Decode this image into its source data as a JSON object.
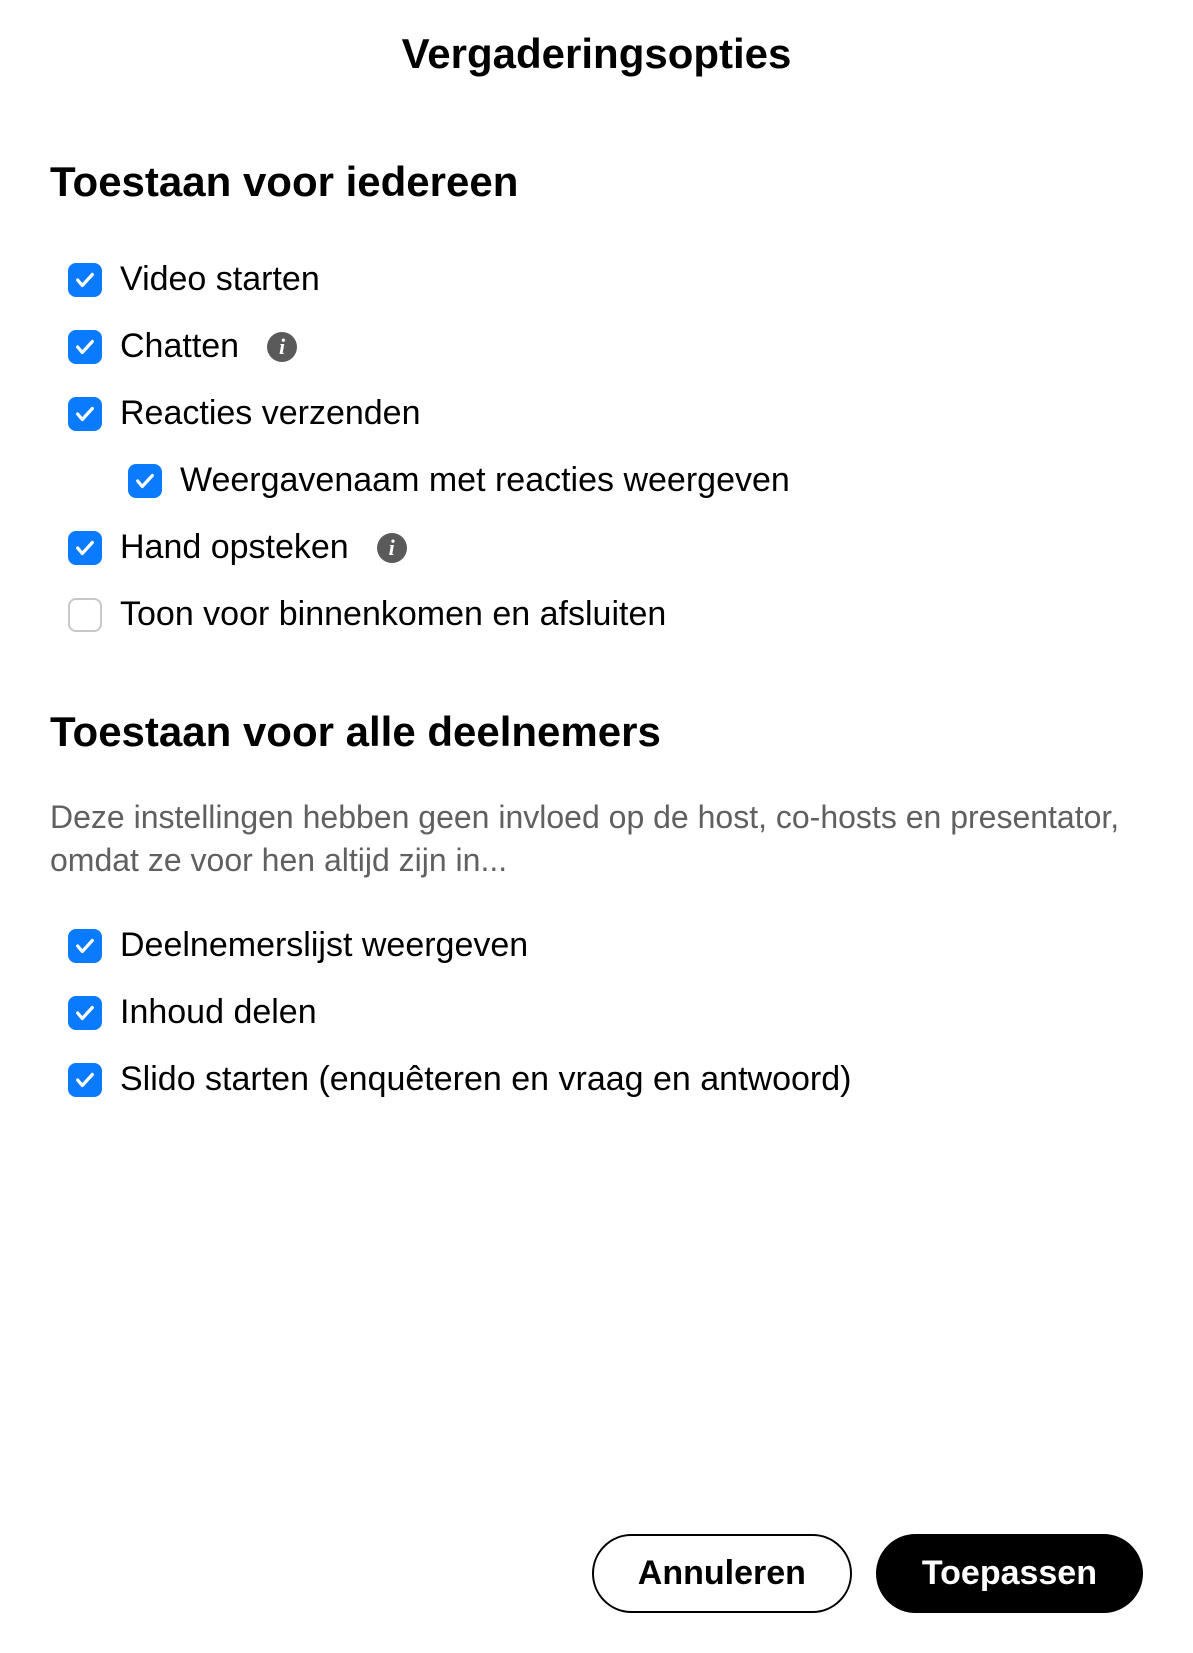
{
  "title": "Vergaderingsopties",
  "section_everyone": {
    "heading": "Toestaan voor iedereen",
    "options": {
      "video_start": {
        "label": "Video starten",
        "checked": true
      },
      "chat": {
        "label": "Chatten",
        "checked": true,
        "info": true
      },
      "send_reactions": {
        "label": "Reacties verzenden",
        "checked": true
      },
      "show_display_name_reactions": {
        "label": "Weergavenaam met reacties weergeven",
        "checked": true
      },
      "raise_hand": {
        "label": "Hand opsteken",
        "checked": true,
        "info": true
      },
      "tone_enter_exit": {
        "label": "Toon voor binnenkomen en afsluiten",
        "checked": false
      }
    }
  },
  "section_participants": {
    "heading": "Toestaan voor alle deelnemers",
    "description": "Deze instellingen hebben geen invloed op de host, co-hosts en presentator, omdat ze voor hen altijd zijn in...",
    "options": {
      "show_participant_list": {
        "label": "Deelnemerslijst weergeven",
        "checked": true
      },
      "share_content": {
        "label": "Inhoud delen",
        "checked": true
      },
      "start_slido": {
        "label": "Slido starten (enquêteren en vraag en antwoord)",
        "checked": true
      }
    }
  },
  "footer": {
    "cancel": "Annuleren",
    "apply": "Toepassen"
  },
  "info_glyph": "i"
}
